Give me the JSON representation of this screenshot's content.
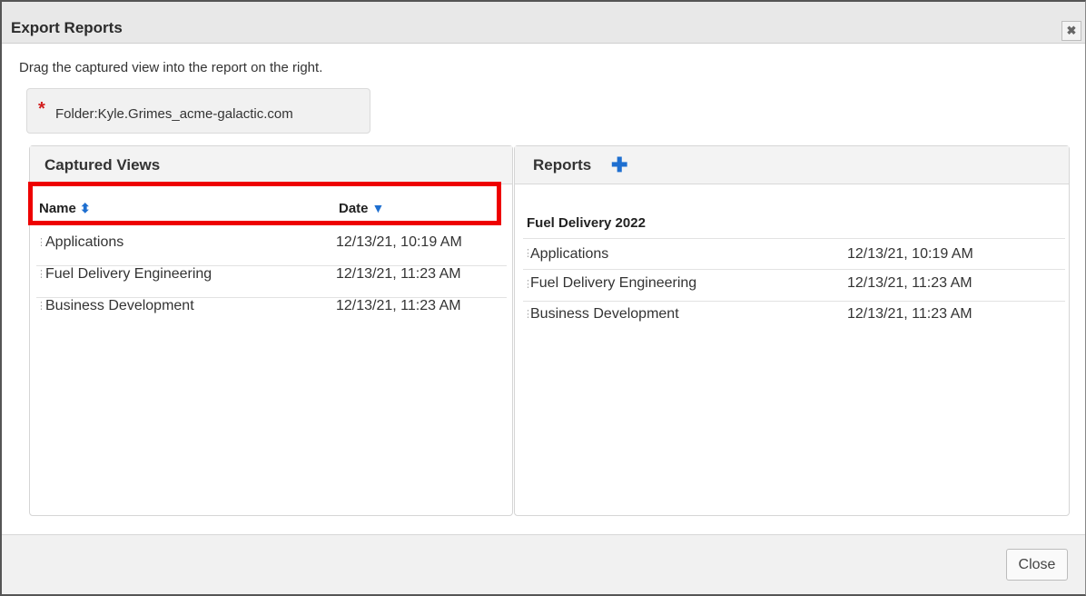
{
  "dialog": {
    "title": "Export Reports",
    "close_icon": "close-x-icon",
    "instructions": "Drag the captured view into the report on the right.",
    "folder": {
      "required_mark": "*",
      "label": "Folder:Kyle.Grimes_acme-galactic.com"
    }
  },
  "captured_views": {
    "title": "Captured Views",
    "columns": {
      "name": "Name",
      "date": "Date"
    },
    "rows": [
      {
        "name": "Applications",
        "date": "12/13/21, 10:19 AM"
      },
      {
        "name": "Fuel Delivery Engineering",
        "date": "12/13/21, 11:23 AM"
      },
      {
        "name": "Business Development",
        "date": "12/13/21, 11:23 AM"
      }
    ]
  },
  "reports": {
    "title": "Reports",
    "add_icon": "plus-icon",
    "report_name": "Fuel Delivery 2022",
    "rows": [
      {
        "name": "Applications",
        "date": "12/13/21, 10:19 AM"
      },
      {
        "name": "Fuel Delivery Engineering",
        "date": "12/13/21, 11:23 AM"
      },
      {
        "name": "Business Development",
        "date": "12/13/21, 11:23 AM"
      }
    ]
  },
  "footer": {
    "close_label": "Close"
  },
  "colors": {
    "accent": "#1e6fd0",
    "highlight": "#ee0000",
    "required": "#d21d1d"
  }
}
